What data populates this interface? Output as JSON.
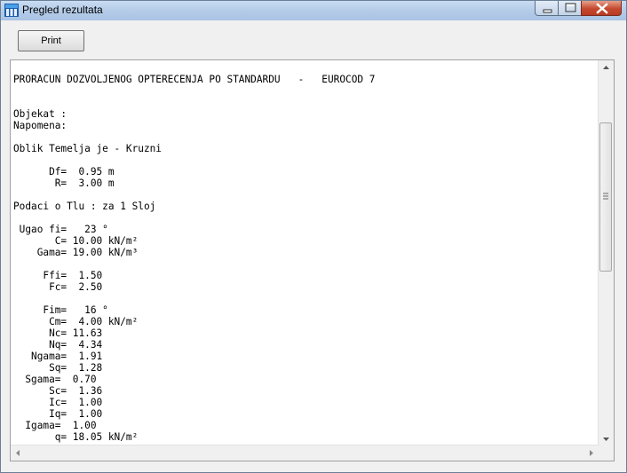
{
  "window": {
    "title": "Pregled rezultata"
  },
  "toolbar": {
    "print_label": "Print"
  },
  "report": {
    "lines": [
      "PRORACUN DOZVOLJENOG OPTERECENJA PO STANDARDU   -   EUROCOD 7",
      "",
      "",
      "Objekat :",
      "Napomena:",
      "",
      "Oblik Temelja je - Kruzni",
      "",
      "      Df=  0.95 m",
      "       R=  3.00 m",
      "",
      "Podaci o Tlu : za 1 Sloj",
      "",
      " Ugao fi=   23 °",
      "       C= 10.00 kN/m²",
      "    Gama= 19.00 kN/m³",
      "",
      "     Ffi=  1.50",
      "      Fc=  2.50",
      "",
      "     Fim=   16 °",
      "      Cm=  4.00 kN/m²",
      "      Nc= 11.63",
      "      Nq=  4.34",
      "   Ngama=  1.91",
      "      Sq=  1.28",
      "  Sgama=  0.70",
      "      Sc=  1.36",
      "      Ic=  1.00",
      "      Iq=  1.00",
      "  Igama=  1.00",
      "       q= 18.05 kN/m²"
    ]
  }
}
